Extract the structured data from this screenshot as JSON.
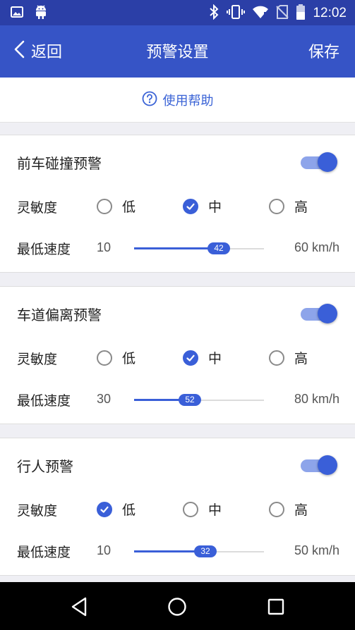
{
  "status_bar": {
    "time": "12:02",
    "left_icons": [
      "image-icon",
      "android-icon"
    ],
    "right_icons": [
      "bluetooth-icon",
      "vibrate-icon",
      "wifi-icon",
      "no-sim-icon",
      "battery-icon"
    ]
  },
  "app_bar": {
    "back_label": "返回",
    "title": "预警设置",
    "save_label": "保存"
  },
  "help": {
    "label": "使用帮助"
  },
  "sections": [
    {
      "title": "前车碰撞预警",
      "enabled": true,
      "sensitivity_label": "灵敏度",
      "options": [
        "低",
        "中",
        "高"
      ],
      "selected": 1,
      "speed_label": "最低速度",
      "speed_min": "10",
      "speed_max": "60 km/h",
      "speed_value": "42",
      "speed_fraction": 0.65
    },
    {
      "title": "车道偏离预警",
      "enabled": true,
      "sensitivity_label": "灵敏度",
      "options": [
        "低",
        "中",
        "高"
      ],
      "selected": 1,
      "speed_label": "最低速度",
      "speed_min": "30",
      "speed_max": "80 km/h",
      "speed_value": "52",
      "speed_fraction": 0.43
    },
    {
      "title": "行人预警",
      "enabled": true,
      "sensitivity_label": "灵敏度",
      "options": [
        "低",
        "中",
        "高"
      ],
      "selected": 0,
      "speed_label": "最低速度",
      "speed_min": "10",
      "speed_max": "50 km/h",
      "speed_value": "32",
      "speed_fraction": 0.55
    }
  ],
  "nav_bar": {
    "buttons": [
      "back-triangle-icon",
      "home-circle-icon",
      "recents-square-icon"
    ]
  },
  "colors": {
    "status_bar": "#2b3fa7",
    "app_bar": "#3654c6",
    "accent": "#3a5fd8",
    "help_text": "#3a63d6"
  }
}
